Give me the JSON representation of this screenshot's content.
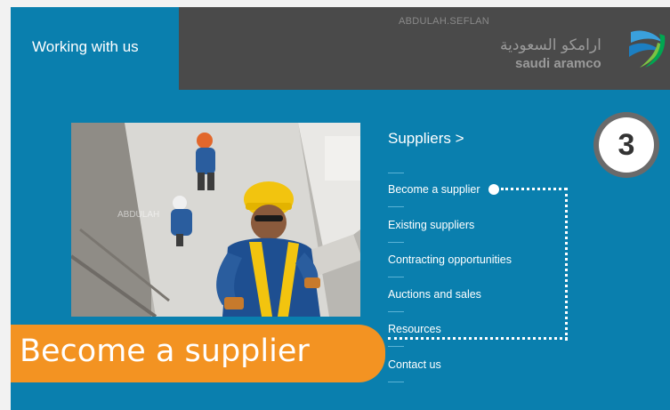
{
  "header": {
    "section_title": "Working with us",
    "watermark": "ABDULAH.SEFLAN",
    "logo_arabic": "ارامكو السعودية",
    "logo_english": "saudi aramco"
  },
  "photo": {
    "watermark": "ABDULAH"
  },
  "menu": {
    "heading": "Suppliers >",
    "items": [
      "Become a supplier",
      "Existing suppliers",
      "Contracting opportunities",
      "Auctions and sales",
      "Resources",
      "Contact us"
    ]
  },
  "step": {
    "number": "3"
  },
  "caption": {
    "text": "Become a supplier"
  },
  "colors": {
    "panel": "#0a7fae",
    "header_dark": "#4a4a4a",
    "caption": "#f39322"
  }
}
